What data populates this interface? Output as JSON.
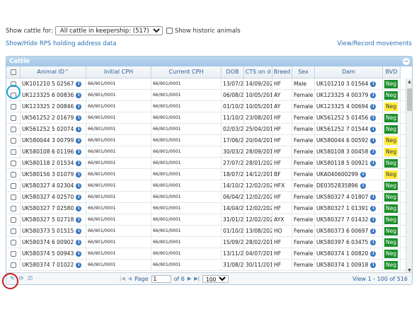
{
  "filter": {
    "label": "Show cattle for:",
    "selected": "All cattle in keepership: (517)",
    "historic_label": "Show historic animals"
  },
  "links": {
    "rps": "Show/Hide RPS holding address data",
    "movements": "View/Record movements"
  },
  "grid": {
    "title": "Cattle",
    "collapse": "−",
    "columns": [
      "",
      "Animal ID",
      "Initial CPH",
      "Current CPH",
      "DOB",
      "CTS on d",
      "Breed",
      "Sex",
      "Dam",
      "BVD"
    ],
    "rows": [
      {
        "aid": "UK101210 5 02567",
        "icph": "66/901/0001",
        "ccph": "66/901/0001",
        "dob": "13/07/2019",
        "cts": "14/09/2020",
        "breed": "HF",
        "sex": "Male",
        "dam": "UK101210 3 01564",
        "bvd": "Neg",
        "bvd_color": "green"
      },
      {
        "aid": "UK123325 6 00836",
        "icph": "66/901/0001",
        "ccph": "66/901/0001",
        "dob": "06/08/2019",
        "cts": "10/05/2017",
        "breed": "AY",
        "sex": "Female",
        "dam": "UK123325 4 00379",
        "bvd": "Neg",
        "bvd_color": "green"
      },
      {
        "aid": "UK123325 2 00846",
        "icph": "66/901/0001",
        "ccph": "66/901/0001",
        "dob": "01/10/2019",
        "cts": "10/05/2017",
        "breed": "AY",
        "sex": "Female",
        "dam": "UK123325 4 00694",
        "bvd": "Neg",
        "bvd_color": "yellow"
      },
      {
        "aid": "UK561252 2 01679",
        "icph": "66/901/0001",
        "ccph": "66/901/0001",
        "dob": "11/10/2017",
        "cts": "23/08/2016",
        "breed": "HF",
        "sex": "Female",
        "dam": "UK561252 5 01456",
        "bvd": "Neg",
        "bvd_color": "green"
      },
      {
        "aid": "UK561252 5 02074",
        "icph": "66/901/0001",
        "ccph": "66/901/0001",
        "dob": "02/03/2017",
        "cts": "25/04/2017",
        "breed": "HF",
        "sex": "Female",
        "dam": "UK561252 7 01544",
        "bvd": "Neg",
        "bvd_color": "green"
      },
      {
        "aid": "UK580044 3 00799",
        "icph": "66/901/0001",
        "ccph": "66/901/0001",
        "dob": "17/06/2013",
        "cts": "20/04/2017",
        "breed": "HF",
        "sex": "Female",
        "dam": "UK580044 6 00592",
        "bvd": "Neg",
        "bvd_color": "yellow"
      },
      {
        "aid": "UK580108 6 01196",
        "icph": "66/901/0001",
        "ccph": "66/901/0001",
        "dob": "30/03/2018",
        "cts": "28/09/2016",
        "breed": "HF",
        "sex": "Female",
        "dam": "UK580108 3 00458",
        "bvd": "Neg",
        "bvd_color": "yellow"
      },
      {
        "aid": "UK580118 2 01534",
        "icph": "66/901/0001",
        "ccph": "66/901/0001",
        "dob": "27/07/2019",
        "cts": "28/01/2020",
        "breed": "HF",
        "sex": "Female",
        "dam": "UK580118 5 00921",
        "bvd": "Neg",
        "bvd_color": "green"
      },
      {
        "aid": "UK580156 3 01079",
        "icph": "66/901/0001",
        "ccph": "66/901/0001",
        "dob": "18/07/2016",
        "cts": "14/12/2016",
        "breed": "BF",
        "sex": "Female",
        "dam": "UKA040600299",
        "bvd": "Neg",
        "bvd_color": "yellow"
      },
      {
        "aid": "UK580327 4 02304",
        "icph": "66/901/0001",
        "ccph": "66/901/0001",
        "dob": "14/10/2019",
        "cts": "12/02/2020",
        "breed": "HFX",
        "sex": "Female",
        "dam": "DE0352835896",
        "bvd": "Neg",
        "bvd_color": "green"
      },
      {
        "aid": "UK580327 4 02570",
        "icph": "66/901/0001",
        "ccph": "66/901/0001",
        "dob": "06/04/2017",
        "cts": "12/02/2020",
        "breed": "HF",
        "sex": "Female",
        "dam": "UK580327 4 01807",
        "bvd": "Neg",
        "bvd_color": "green"
      },
      {
        "aid": "UK580327 7 02580",
        "icph": "66/901/0001",
        "ccph": "66/901/0001",
        "dob": "14/04/2017",
        "cts": "12/02/2020",
        "breed": "HF",
        "sex": "Female",
        "dam": "UK580327 1 01391",
        "bvd": "Neg",
        "bvd_color": "green"
      },
      {
        "aid": "UK580327 5 02718",
        "icph": "66/901/0001",
        "ccph": "66/901/0001",
        "dob": "31/01/2018",
        "cts": "12/02/2020",
        "breed": "AYX",
        "sex": "Female",
        "dam": "UK580327 7 01432",
        "bvd": "Neg",
        "bvd_color": "green"
      },
      {
        "aid": "UK580373 5 01515",
        "icph": "66/901/0001",
        "ccph": "66/901/0001",
        "dob": "01/10/2018",
        "cts": "13/08/2020",
        "breed": "HO",
        "sex": "Female",
        "dam": "UK580373 6 00697",
        "bvd": "Neg",
        "bvd_color": "green"
      },
      {
        "aid": "UK580374 6 00902",
        "icph": "66/901/0001",
        "ccph": "66/901/0001",
        "dob": "15/09/2018",
        "cts": "28/02/2016",
        "breed": "HF",
        "sex": "Female",
        "dam": "UK580397 6 03475",
        "bvd": "Neg",
        "bvd_color": "green"
      },
      {
        "aid": "UK580374 5 00943",
        "icph": "66/901/0001",
        "ccph": "66/901/0001",
        "dob": "13/11/2012",
        "cts": "04/07/2016",
        "breed": "HF",
        "sex": "Female",
        "dam": "UK580374 1 00820",
        "bvd": "Neg",
        "bvd_color": "green"
      },
      {
        "aid": "UK580374 7 01022",
        "icph": "66/901/0001",
        "ccph": "66/901/0001",
        "dob": "31/08/2018",
        "cts": "30/11/2016",
        "breed": "HF",
        "sex": "Female",
        "dam": "UK580374 1 00918",
        "bvd": "Neg",
        "bvd_color": "green"
      }
    ]
  },
  "pager": {
    "page_label": "Page",
    "page_value": "1",
    "of_label": "of 6",
    "per_page": "100",
    "view": "View 1 - 100 of 516"
  },
  "icons": {
    "sort": "sort-asc-icon",
    "info": "info-icon",
    "edit": "pencil-icon",
    "refresh": "refresh-icon",
    "export": "export-icon"
  }
}
